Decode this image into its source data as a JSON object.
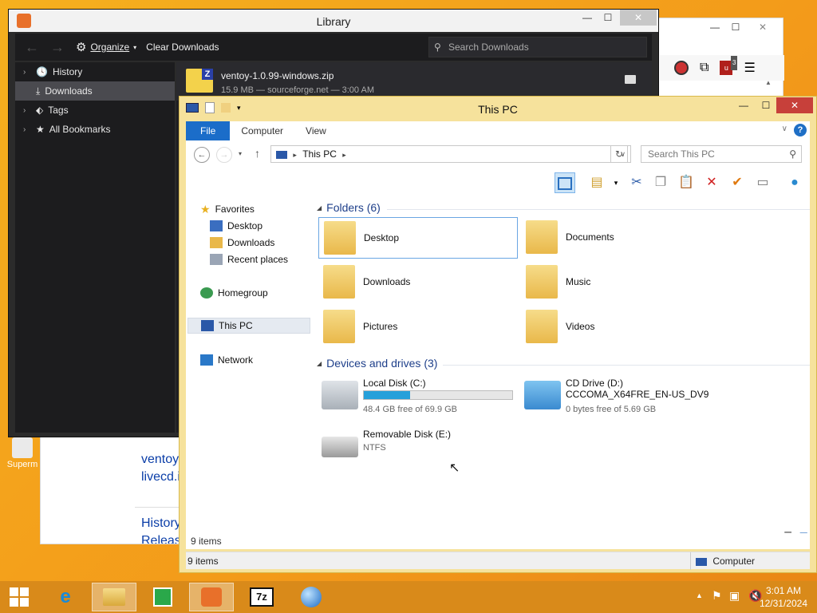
{
  "browser": {
    "min": "—",
    "max": "☐",
    "close": "✕",
    "links": [
      "ventoy",
      "livecd.i",
      "History",
      "Releas"
    ],
    "badge_count": "3"
  },
  "library": {
    "title": "Library",
    "toolbar": {
      "organize": "Organize",
      "clear": "Clear Downloads",
      "search_placeholder": "Search Downloads"
    },
    "sidebar": [
      {
        "label": "History",
        "icon": "clock-icon",
        "selected": false
      },
      {
        "label": "Downloads",
        "icon": "download-icon",
        "selected": true
      },
      {
        "label": "Tags",
        "icon": "tag-icon",
        "selected": false
      },
      {
        "label": "All Bookmarks",
        "icon": "star-icon",
        "selected": false
      }
    ],
    "download": {
      "name": "ventoy-1.0.99-windows.zip",
      "meta": "15.9 MB — sourceforge.net — 3:00 AM"
    }
  },
  "thispc": {
    "title": "This PC",
    "tabs": [
      "File",
      "Computer",
      "View"
    ],
    "address": "This PC",
    "search_placeholder": "Search This PC",
    "nav": {
      "favorites": "Favorites",
      "fav_items": [
        "Desktop",
        "Downloads",
        "Recent places"
      ],
      "homegroup": "Homegroup",
      "thispc": "This PC",
      "network": "Network"
    },
    "folders_header": "Folders (6)",
    "folders": [
      "Desktop",
      "Documents",
      "Downloads",
      "Music",
      "Pictures",
      "Videos"
    ],
    "devices_header": "Devices and drives (3)",
    "drives": {
      "c": {
        "name": "Local Disk (C:)",
        "free": "48.4 GB free of 69.9 GB",
        "used_fraction": 0.31
      },
      "d": {
        "name": "CD Drive (D:)",
        "label": "CCCOMA_X64FRE_EN-US_DV9",
        "free": "0 bytes free of 5.69 GB"
      },
      "e": {
        "name": "Removable Disk (E:)",
        "fs": "NTFS"
      }
    },
    "items_count": "9 items",
    "status_items": "9 items",
    "status_location": "Computer"
  },
  "desktop_icon": "Superm",
  "taskbar": {
    "time": "3:01 AM",
    "date": "12/31/2024"
  }
}
